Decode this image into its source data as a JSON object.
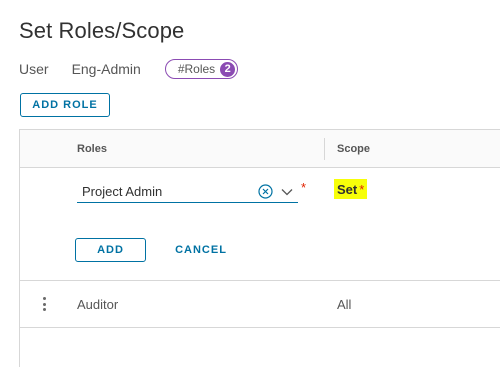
{
  "page": {
    "title": "Set Roles/Scope"
  },
  "meta": {
    "user_label": "User",
    "group": "Eng-Admin",
    "roles_badge": "#Roles",
    "roles_count": "2"
  },
  "actions": {
    "add_role": "ADD ROLE"
  },
  "grid": {
    "columns": [
      "Roles",
      "Scope"
    ],
    "edit_row": {
      "role_value": "Project Admin",
      "required_mark": "*",
      "scope_value": "Set",
      "scope_required": "*",
      "add": "ADD",
      "cancel": "CANCEL"
    },
    "rows": [
      {
        "role": "Auditor",
        "scope": "All"
      }
    ]
  },
  "colors": {
    "accent": "#0072a3",
    "badge": "#8b4bb3",
    "highlight": "#f7ff0a",
    "required": "#e12200"
  }
}
